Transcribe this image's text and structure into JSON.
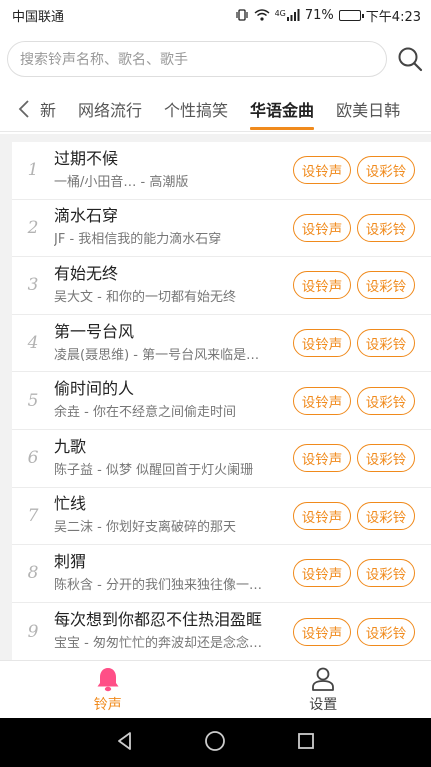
{
  "status_bar": {
    "carrier": "中国联通",
    "network": "4G",
    "battery": "71%",
    "battery_level": 0.71,
    "time": "下午4:23"
  },
  "search": {
    "placeholder": "搜索铃声名称、歌名、歌手"
  },
  "tabs": [
    {
      "label": "新"
    },
    {
      "label": "网络流行"
    },
    {
      "label": "个性搞笑"
    },
    {
      "label": "华语金曲",
      "active": true
    },
    {
      "label": "欧美日韩"
    }
  ],
  "buttons": {
    "ringtone": "设铃声",
    "color_ring": "设彩铃"
  },
  "songs": [
    {
      "index": "1",
      "title": "过期不候",
      "sub": "一桶/小田音… - 高潮版"
    },
    {
      "index": "2",
      "title": "滴水石穿",
      "sub": "JF - 我相信我的能力滴水石穿"
    },
    {
      "index": "3",
      "title": "有始无终",
      "sub": "吴大文 - 和你的一切都有始无终"
    },
    {
      "index": "4",
      "title": "第一号台风",
      "sub": "凌晨(聂思维) - 第一号台风来临是…"
    },
    {
      "index": "5",
      "title": "偷时间的人",
      "sub": "余垚 - 你在不经意之间偷走时间"
    },
    {
      "index": "6",
      "title": "九歌",
      "sub": "陈子益 - 似梦 似醒回首于灯火阑珊"
    },
    {
      "index": "7",
      "title": "忙线",
      "sub": "吴二沫 - 你划好支离破碎的那天"
    },
    {
      "index": "8",
      "title": "刺猬",
      "sub": "陈秋含 - 分开的我们独来独往像一…"
    },
    {
      "index": "9",
      "title": "每次想到你都忍不住热泪盈眶",
      "sub": "宝宝 - 匆匆忙忙的奔波却还是念念…"
    }
  ],
  "bottom_nav": [
    {
      "label": "铃声",
      "icon": "bell-icon",
      "active": true
    },
    {
      "label": "设置",
      "icon": "user-icon"
    }
  ],
  "colors": {
    "accent": "#f08a1c",
    "bell": "#ff4f87"
  }
}
